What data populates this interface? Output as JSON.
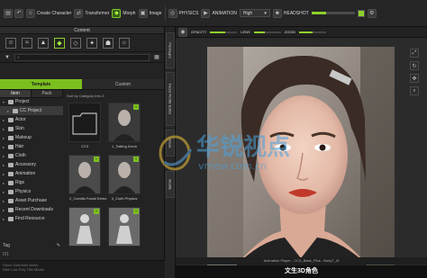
{
  "toolbar": {
    "create_character": "Create Character",
    "transformer": "Transformer",
    "morph": "Morph",
    "image": "Image",
    "physics": "PHYSICS",
    "animation": "ANIMATION",
    "quality_value": "High",
    "headshot": "HEADSHOT",
    "slider_fraction": 0.35
  },
  "content": {
    "title": "Content",
    "search_placeholder": "",
    "tabs": [
      "Template",
      "Custom"
    ],
    "sub_tabs": [
      "Item",
      "Pack"
    ],
    "sort_label": "Sort by Category  Info Z",
    "tree": [
      {
        "label": "Project",
        "expanded": true,
        "selected": false
      },
      {
        "label": "CC Project",
        "expanded": false,
        "selected": true
      },
      {
        "label": "Actor",
        "expanded": false,
        "selected": false
      },
      {
        "label": "Skin",
        "expanded": false,
        "selected": false
      },
      {
        "label": "Makeup",
        "expanded": false,
        "selected": false
      },
      {
        "label": "Hair",
        "expanded": false,
        "selected": false
      },
      {
        "label": "Cloth",
        "expanded": false,
        "selected": false
      },
      {
        "label": "Accessory",
        "expanded": false,
        "selected": false
      },
      {
        "label": "Animation",
        "expanded": false,
        "selected": false
      },
      {
        "label": "Rigs",
        "expanded": false,
        "selected": false
      },
      {
        "label": "Physics",
        "expanded": false,
        "selected": false
      },
      {
        "label": "Asset Purchase",
        "expanded": false,
        "selected": false
      },
      {
        "label": "Recent Downloads",
        "expanded": false,
        "selected": false
      },
      {
        "label": "Find Resource",
        "expanded": false,
        "selected": false
      }
    ],
    "tag_label": "Tag",
    "tag_count": "0/1",
    "thumbnails": [
      {
        "label": "CC3",
        "kind": "folder"
      },
      {
        "label": "1_Talking Kevin",
        "kind": "photo-man"
      },
      {
        "label": "2_Camilla Facial Demo",
        "kind": "photo-woman"
      },
      {
        "label": "3_Cloth Physics",
        "kind": "photo-woman2"
      },
      {
        "label": "",
        "kind": "statue"
      },
      {
        "label": "",
        "kind": "statue"
      }
    ],
    "status_line1": "Show Subfolder Items",
    "status_line2": "Nike Low Poly Title Model"
  },
  "vtabs": [
    "Packages",
    "Facial Profile Editor",
    "Visual",
    "Modify"
  ],
  "viewport": {
    "opacity_label": "OPACITY",
    "lens_label": "LENS",
    "zoom_label": "ZOOM",
    "opacity_fraction": 0.55,
    "lens_fraction": 0.4,
    "zoom_fraction": 0.5,
    "footer_text": "Animation Player - CC3_Base_Plus - BodyT_M",
    "caption": "文生3D角色"
  },
  "watermark": {
    "text_cn": "华锐视点",
    "text_url": "vrnew.com.cn"
  },
  "colors": {
    "accent": "#7bbf1f",
    "panel": "#232323",
    "toolbar": "#262626"
  }
}
